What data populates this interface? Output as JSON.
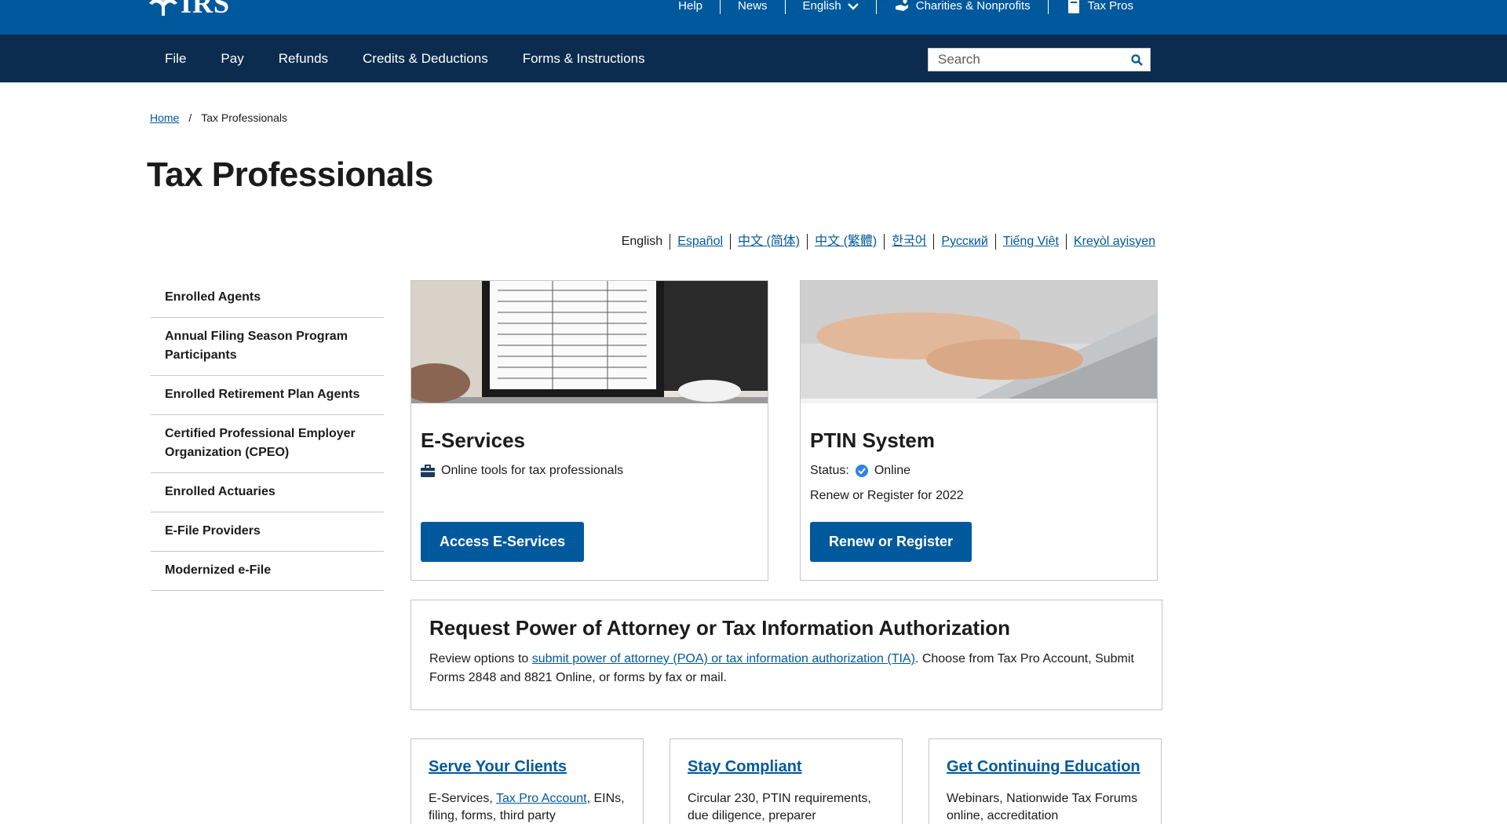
{
  "header": {
    "logo_text": "IRS",
    "utility": [
      {
        "label": "Help"
      },
      {
        "label": "News"
      },
      {
        "label": "English"
      },
      {
        "label": "Charities & Nonprofits"
      },
      {
        "label": "Tax Pros"
      }
    ]
  },
  "nav": {
    "items": [
      "File",
      "Pay",
      "Refunds",
      "Credits & Deductions",
      "Forms & Instructions"
    ],
    "search_placeholder": "Search"
  },
  "breadcrumb": {
    "home": "Home",
    "separator": "/",
    "current": "Tax Professionals"
  },
  "page_title": "Tax Professionals",
  "languages": {
    "current": "English",
    "links": [
      "Español",
      "中文 (简体)",
      "中文 (繁體)",
      "한국어",
      "Русский",
      "Tiếng Việt",
      "Kreyòl ayisyen"
    ]
  },
  "sidebar": {
    "items": [
      "Enrolled Agents",
      "Annual Filing Season Program Participants",
      "Enrolled Retirement Plan Agents",
      "Certified Professional Employer Organization (CPEO)",
      "Enrolled Actuaries",
      "E-File Providers",
      "Modernized e-File"
    ]
  },
  "eservices": {
    "title": "E-Services",
    "description": "Online tools for tax professionals",
    "button": "Access E-Services"
  },
  "ptin": {
    "title": "PTIN System",
    "status_label": "Status:",
    "status_value": "Online",
    "renew_text": "Renew or Register for 2022",
    "button": "Renew or Register"
  },
  "poa": {
    "title": "Request Power of Attorney or Tax Information Authorization",
    "text_before": "Review options to ",
    "link": "submit power of attorney (POA) or tax information authorization (TIA)",
    "text_after": ". Choose from Tax Pro Account, Submit Forms 2848 and 8821 Online, or forms by fax or mail."
  },
  "cards": [
    {
      "title": "Serve Your Clients",
      "text_before": "E-Services, ",
      "link": "Tax Pro Account",
      "text_after": ", EINs, filing, forms, third party"
    },
    {
      "title": "Stay Compliant",
      "text": "Circular 230, PTIN requirements, due diligence, preparer"
    },
    {
      "title": "Get Continuing Education",
      "text": "Webinars, Nationwide Tax Forums online, accreditation"
    }
  ],
  "colors": {
    "top_bar": "#00599c",
    "main_nav": "#0b2c4e",
    "link": "#00599c",
    "button": "#00599c",
    "status_check": "#2d84e5"
  }
}
